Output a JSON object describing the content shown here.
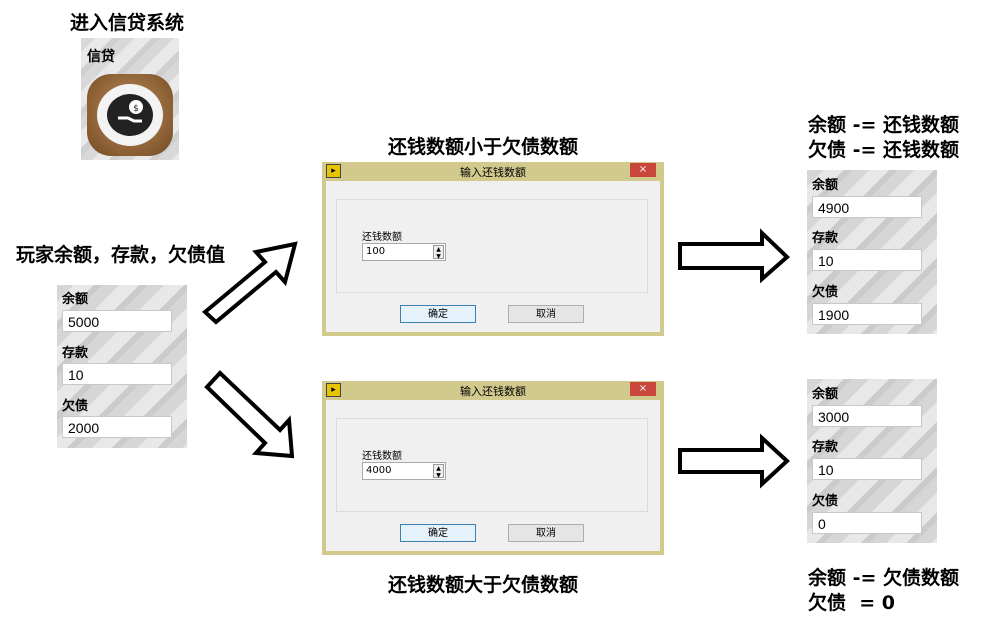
{
  "captions": {
    "enter_credit": "进入信贷系统",
    "player_values": "玩家余额，存款，欠债值",
    "less_than": "还钱数额小于欠债数额",
    "greater_than": "还钱数额大于欠债数额",
    "result1_line1": "余额 -= 还钱数额",
    "result1_line2": "欠债 -= 还钱数额",
    "result2_line1": "余额 -= 欠债数额",
    "result2_line2": "欠债  = 0"
  },
  "credit_icon": {
    "label": "信贷",
    "icon": "money-hand-icon"
  },
  "initial_panel": {
    "balance_label": "余额",
    "balance": "5000",
    "deposit_label": "存款",
    "deposit": "10",
    "debt_label": "欠债",
    "debt": "2000"
  },
  "dialog_top": {
    "title": "输入还钱数额",
    "close": "×",
    "field_label": "还钱数额",
    "field_value": "100",
    "ok": "确定",
    "cancel": "取消"
  },
  "dialog_bottom": {
    "title": "输入还钱数额",
    "close": "×",
    "field_label": "还钱数额",
    "field_value": "4000",
    "ok": "确定",
    "cancel": "取消"
  },
  "result_panel_top": {
    "balance_label": "余额",
    "balance": "4900",
    "deposit_label": "存款",
    "deposit": "10",
    "debt_label": "欠债",
    "debt": "1900"
  },
  "result_panel_bottom": {
    "balance_label": "余额",
    "balance": "3000",
    "deposit_label": "存款",
    "deposit": "10",
    "debt_label": "欠债",
    "debt": "0"
  },
  "colors": {
    "dialog_frame": "#d2c98d",
    "close_button": "#c9463d",
    "arrow_stroke": "#000000"
  }
}
